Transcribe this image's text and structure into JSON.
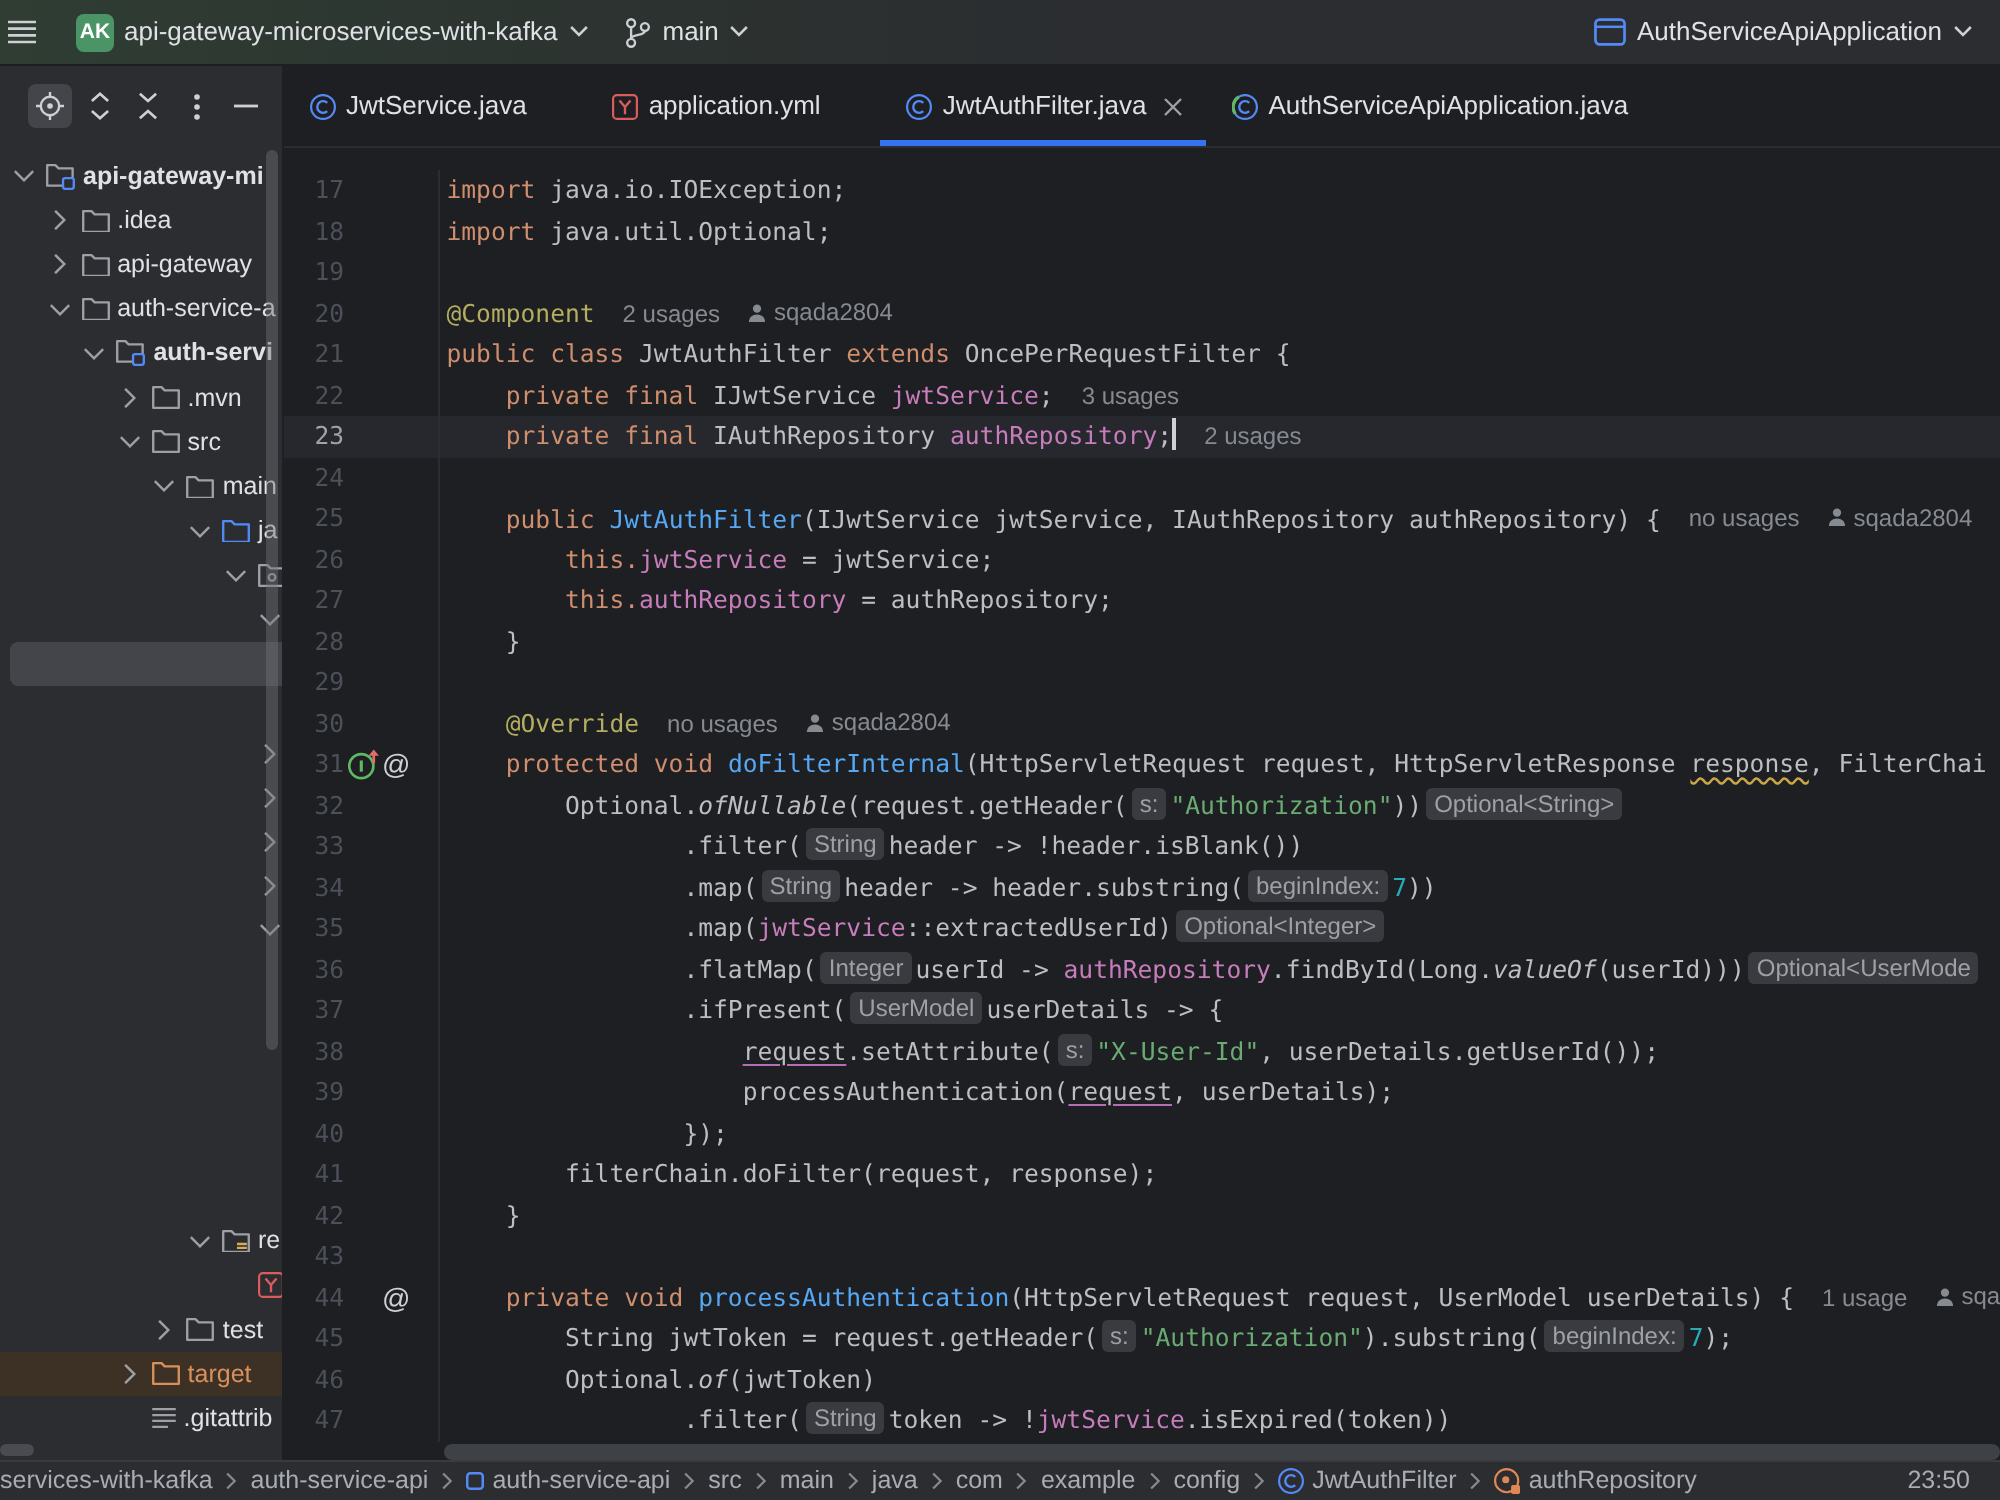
{
  "title_bar": {
    "badge": "AK",
    "project": "api-gateway-microservices-with-kafka",
    "branch": "main",
    "run_configuration": "AuthServiceApiApplication"
  },
  "project_toolbar": [
    {
      "kind": "locate",
      "on": true
    },
    {
      "kind": "expand",
      "on": false
    },
    {
      "kind": "collapse",
      "on": false
    },
    {
      "kind": "more",
      "on": false
    },
    {
      "kind": "hide",
      "on": false
    }
  ],
  "project_tree": [
    {
      "label": "api-gateway-mi",
      "kind": "module",
      "expanded": true,
      "selected": false,
      "children": [
        {
          "label": ".idea",
          "kind": "folder",
          "expanded": false,
          "selected": false
        },
        {
          "label": "api-gateway",
          "kind": "folder",
          "expanded": false,
          "selected": false
        },
        {
          "label": "auth-service-a",
          "kind": "folder",
          "expanded": true,
          "selected": false,
          "children": [
            {
              "label": "auth-servi",
              "kind": "module",
              "expanded": true,
              "selected": false,
              "children": [
                {
                  "label": ".mvn",
                  "kind": "folder",
                  "expanded": false,
                  "selected": false
                },
                {
                  "label": "src",
                  "kind": "folder",
                  "expanded": true,
                  "selected": false,
                  "children": [
                    {
                      "label": "main",
                      "kind": "folder",
                      "expanded": true,
                      "selected": false,
                      "children": [
                        {
                          "label": "ja",
                          "kind": "source-root",
                          "expanded": true,
                          "selected": false,
                          "children": [
                            {
                              "kind": "package",
                              "expanded": true,
                              "selected": false,
                              "children": [
                                {
                                  "expanded": true,
                                  "selected": false,
                                  "children": [
                                    {
                                      "selected": true
                                    },
                                    {
                                      "selected": false
                                    }
                                  ]
                                },
                                {
                                  "expanded": false,
                                  "selected": false
                                },
                                {
                                  "expanded": false,
                                  "selected": false
                                },
                                {
                                  "expanded": false,
                                  "selected": false
                                },
                                {
                                  "expanded": false,
                                  "selected": false
                                },
                                {
                                  "expanded": true,
                                  "selected": false,
                                  "children": [
                                    {
                                      "selected": false
                                    },
                                    {
                                      "selected": false
                                    },
                                    {
                                      "selected": false
                                    },
                                    {
                                      "selected": false
                                    },
                                    {
                                      "selected": false
                                    },
                                    {
                                      "selected": false
                                    }
                                  ]
                                }
                              ]
                            }
                          ]
                        },
                        {
                          "label": "re",
                          "kind": "resources",
                          "expanded": true,
                          "selected": false,
                          "children": [
                            {
                              "kind": "yaml",
                              "selected": false
                            }
                          ]
                        }
                      ]
                    },
                    {
                      "label": "test",
                      "kind": "folder",
                      "expanded": false,
                      "selected": false
                    }
                  ]
                },
                {
                  "label": "target",
                  "kind": "excluded",
                  "expanded": false,
                  "selected": false
                },
                {
                  "label": ".gitattrib",
                  "kind": "text",
                  "selected": false
                }
              ]
            }
          ]
        }
      ]
    }
  ],
  "tabs": [
    {
      "label": "JwtService.java",
      "kind": "class",
      "selected": false
    },
    {
      "label": "application.yml",
      "kind": "yaml",
      "selected": false
    },
    {
      "label": "JwtAuthFilter.java",
      "kind": "class",
      "selected": true
    },
    {
      "label": "AuthServiceApiApplication.java",
      "kind": "runnable-class",
      "selected": false
    }
  ],
  "editor": {
    "lines": [
      {
        "number": "17",
        "tokens": [
          {
            "kind": "keyword",
            "text": "import"
          },
          {
            "kind": "plain",
            "text": " java.io.IOException;"
          }
        ]
      },
      {
        "number": "18",
        "tokens": [
          {
            "kind": "keyword",
            "text": "import"
          },
          {
            "kind": "plain",
            "text": " java.util.Optional;"
          }
        ]
      },
      {
        "number": "19"
      },
      {
        "number": "20",
        "tokens": [
          {
            "kind": "annotation",
            "text": "@Component"
          },
          {
            "kind": "usages",
            "text": "2 usages"
          },
          {
            "kind": "author",
            "text": "sqada2804"
          }
        ]
      },
      {
        "number": "21",
        "tokens": [
          {
            "kind": "keyword",
            "text": "public class "
          },
          {
            "kind": "plain",
            "text": "JwtAuthFilter "
          },
          {
            "kind": "keyword",
            "text": "extends "
          },
          {
            "kind": "plain",
            "text": "OncePerRequestFilter {"
          }
        ]
      },
      {
        "number": "22",
        "tokens": [
          {
            "kind": "keyword",
            "text": "    private final "
          },
          {
            "kind": "plain",
            "text": "IJwtService "
          },
          {
            "kind": "field",
            "text": "jwtService"
          },
          {
            "kind": "plain",
            "text": ";"
          },
          {
            "kind": "usages",
            "text": "3 usages"
          }
        ]
      },
      {
        "number": "23",
        "current": true,
        "tokens": [
          {
            "kind": "keyword",
            "text": "    private final "
          },
          {
            "kind": "plain",
            "text": "IAuthRepository "
          },
          {
            "kind": "field",
            "text": "authRepository"
          },
          {
            "kind": "plain",
            "text": ";"
          },
          {
            "kind": "usages",
            "text": "2 usages"
          }
        ]
      },
      {
        "number": "24"
      },
      {
        "number": "25",
        "tokens": [
          {
            "kind": "keyword",
            "text": "    public "
          },
          {
            "kind": "declaration",
            "text": "JwtAuthFilter"
          },
          {
            "kind": "plain",
            "text": "(IJwtService jwtService, IAuthRepository authRepository) {"
          },
          {
            "kind": "usages",
            "text": "no usages"
          },
          {
            "kind": "author",
            "text": "sqada2804"
          }
        ]
      },
      {
        "number": "26",
        "tokens": [
          {
            "kind": "keyword",
            "text": "        this."
          },
          {
            "kind": "field",
            "text": "jwtService"
          },
          {
            "kind": "plain",
            "text": " = jwtService;"
          }
        ]
      },
      {
        "number": "27",
        "tokens": [
          {
            "kind": "keyword",
            "text": "        this."
          },
          {
            "kind": "field",
            "text": "authRepository"
          },
          {
            "kind": "plain",
            "text": " = authRepository;"
          }
        ]
      },
      {
        "number": "28",
        "tokens": [
          {
            "kind": "plain",
            "text": "    }"
          }
        ]
      },
      {
        "number": "29"
      },
      {
        "number": "30",
        "tokens": [
          {
            "kind": "annotation",
            "text": "    @Override"
          },
          {
            "kind": "usages",
            "text": "no usages"
          },
          {
            "kind": "author",
            "text": "sqada2804"
          }
        ]
      },
      {
        "number": "31",
        "gutter": [
          {
            "kind": "implements"
          },
          {
            "kind": "glyph",
            "text": "@"
          }
        ],
        "tokens": [
          {
            "kind": "keyword",
            "text": "    protected void "
          },
          {
            "kind": "declaration",
            "text": "doFilterInternal"
          },
          {
            "kind": "plain",
            "text": "(HttpServletRequest request, HttpServletResponse "
          },
          {
            "kind": "warning",
            "text": "response"
          },
          {
            "kind": "plain",
            "text": ", FilterChai"
          }
        ]
      },
      {
        "number": "32",
        "tokens": [
          {
            "kind": "plain",
            "text": "        Optional."
          },
          {
            "kind": "static",
            "text": "ofNullable"
          },
          {
            "kind": "plain",
            "text": "(request.getHeader("
          },
          {
            "kind": "hint",
            "text": "s:"
          },
          {
            "kind": "string",
            "text": "\"Authorization\""
          },
          {
            "kind": "plain",
            "text": "))"
          },
          {
            "kind": "hint",
            "text": "Optional<String>"
          }
        ]
      },
      {
        "number": "33",
        "tokens": [
          {
            "kind": "plain",
            "text": "                .filter("
          },
          {
            "kind": "hint",
            "text": "String"
          },
          {
            "kind": "plain",
            "text": "header -> !header.isBlank())"
          }
        ]
      },
      {
        "number": "34",
        "tokens": [
          {
            "kind": "plain",
            "text": "                .map("
          },
          {
            "kind": "hint",
            "text": "String"
          },
          {
            "kind": "plain",
            "text": "header -> header.substring("
          },
          {
            "kind": "hint",
            "text": "beginIndex:"
          },
          {
            "kind": "number",
            "text": "7"
          },
          {
            "kind": "plain",
            "text": "))"
          }
        ]
      },
      {
        "number": "35",
        "tokens": [
          {
            "kind": "plain",
            "text": "                .map("
          },
          {
            "kind": "field",
            "text": "jwtService"
          },
          {
            "kind": "plain",
            "text": "::extractedUserId)"
          },
          {
            "kind": "hint",
            "text": "Optional<Integer>"
          }
        ]
      },
      {
        "number": "36",
        "tokens": [
          {
            "kind": "plain",
            "text": "                .flatMap("
          },
          {
            "kind": "hint",
            "text": "Integer"
          },
          {
            "kind": "plain",
            "text": "userId -> "
          },
          {
            "kind": "field",
            "text": "authRepository"
          },
          {
            "kind": "plain",
            "text": ".findById(Long."
          },
          {
            "kind": "static",
            "text": "valueOf"
          },
          {
            "kind": "plain",
            "text": "(userId)))"
          },
          {
            "kind": "hint",
            "text": "Optional<UserMode"
          }
        ]
      },
      {
        "number": "37",
        "tokens": [
          {
            "kind": "plain",
            "text": "                .ifPresent("
          },
          {
            "kind": "hint",
            "text": "UserModel"
          },
          {
            "kind": "plain",
            "text": "userDetails -> {"
          }
        ]
      },
      {
        "number": "38",
        "tokens": [
          {
            "kind": "underlined",
            "text": "                    request"
          },
          {
            "kind": "plain",
            "text": ".setAttribute("
          },
          {
            "kind": "hint",
            "text": "s:"
          },
          {
            "kind": "string",
            "text": "\"X-User-Id\""
          },
          {
            "kind": "plain",
            "text": ", userDetails.getUserId());"
          }
        ]
      },
      {
        "number": "39",
        "tokens": [
          {
            "kind": "plain",
            "text": "                    processAuthentication("
          },
          {
            "kind": "underlined",
            "text": "request"
          },
          {
            "kind": "plain",
            "text": ", userDetails);"
          }
        ]
      },
      {
        "number": "40",
        "tokens": [
          {
            "kind": "plain",
            "text": "                });"
          }
        ]
      },
      {
        "number": "41",
        "tokens": [
          {
            "kind": "plain",
            "text": "        filterChain.doFilter(request, response);"
          }
        ]
      },
      {
        "number": "42",
        "tokens": [
          {
            "kind": "plain",
            "text": "    }"
          }
        ]
      },
      {
        "number": "43"
      },
      {
        "number": "44",
        "gutter": [
          {
            "kind": "glyph",
            "text": "@"
          }
        ],
        "tokens": [
          {
            "kind": "keyword",
            "text": "    private void "
          },
          {
            "kind": "declaration",
            "text": "processAuthentication"
          },
          {
            "kind": "plain",
            "text": "(HttpServletRequest request, UserModel userDetails) {"
          },
          {
            "kind": "usages",
            "text": "1 usage"
          },
          {
            "kind": "author",
            "text": "sqa"
          }
        ]
      },
      {
        "number": "45",
        "tokens": [
          {
            "kind": "plain",
            "text": "        String jwtToken = request.getHeader("
          },
          {
            "kind": "hint",
            "text": "s:"
          },
          {
            "kind": "string",
            "text": "\"Authorization\""
          },
          {
            "kind": "plain",
            "text": ").substring("
          },
          {
            "kind": "hint",
            "text": "beginIndex:"
          },
          {
            "kind": "number",
            "text": "7"
          },
          {
            "kind": "plain",
            "text": ");"
          }
        ]
      },
      {
        "number": "46",
        "tokens": [
          {
            "kind": "plain",
            "text": "        Optional."
          },
          {
            "kind": "static",
            "text": "of"
          },
          {
            "kind": "plain",
            "text": "(jwtToken)"
          }
        ]
      },
      {
        "number": "47",
        "tokens": [
          {
            "kind": "plain",
            "text": "                .filter("
          },
          {
            "kind": "hint",
            "text": "String"
          },
          {
            "kind": "plain",
            "text": "token -> !"
          },
          {
            "kind": "field",
            "text": "jwtService"
          },
          {
            "kind": "plain",
            "text": ".isExpired(token))"
          }
        ]
      }
    ]
  },
  "status_bar": {
    "breadcrumbs": [
      {
        "label": "services-with-kafka"
      },
      {
        "label": "auth-service-api"
      },
      {
        "label": "auth-service-api",
        "kind": "module"
      },
      {
        "label": "src"
      },
      {
        "label": "main"
      },
      {
        "label": "java"
      },
      {
        "label": "com"
      },
      {
        "label": "example"
      },
      {
        "label": "config"
      },
      {
        "label": "JwtAuthFilter",
        "kind": "class"
      },
      {
        "label": "authRepository",
        "kind": "field"
      }
    ],
    "time": "23:50"
  }
}
